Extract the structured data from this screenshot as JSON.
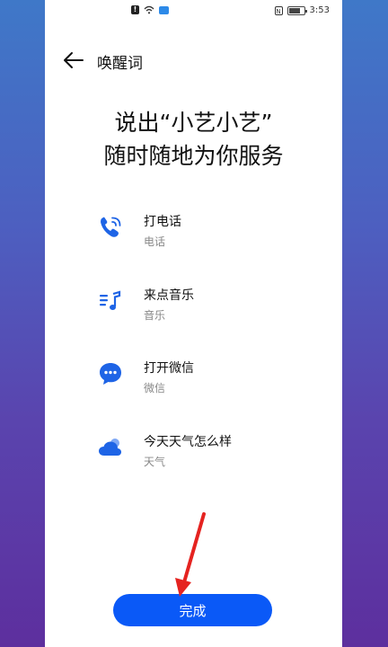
{
  "status_bar": {
    "time": "3:53",
    "battery_level": 0.8
  },
  "header": {
    "title": "唤醒词"
  },
  "headline": {
    "line1": "说出“小艺小艺”",
    "line2": "随时随地为你服务"
  },
  "items": [
    {
      "title": "打电话",
      "subtitle": "电话",
      "icon": "phone-icon"
    },
    {
      "title": "来点音乐",
      "subtitle": "音乐",
      "icon": "music-icon"
    },
    {
      "title": "打开微信",
      "subtitle": "微信",
      "icon": "chat-icon"
    },
    {
      "title": "今天天气怎么样",
      "subtitle": "天气",
      "icon": "weather-icon"
    }
  ],
  "done_button": {
    "label": "完成"
  },
  "colors": {
    "accent": "#0a59f7",
    "icon_blue": "#1e64e6",
    "annotation_arrow": "#e52320"
  }
}
